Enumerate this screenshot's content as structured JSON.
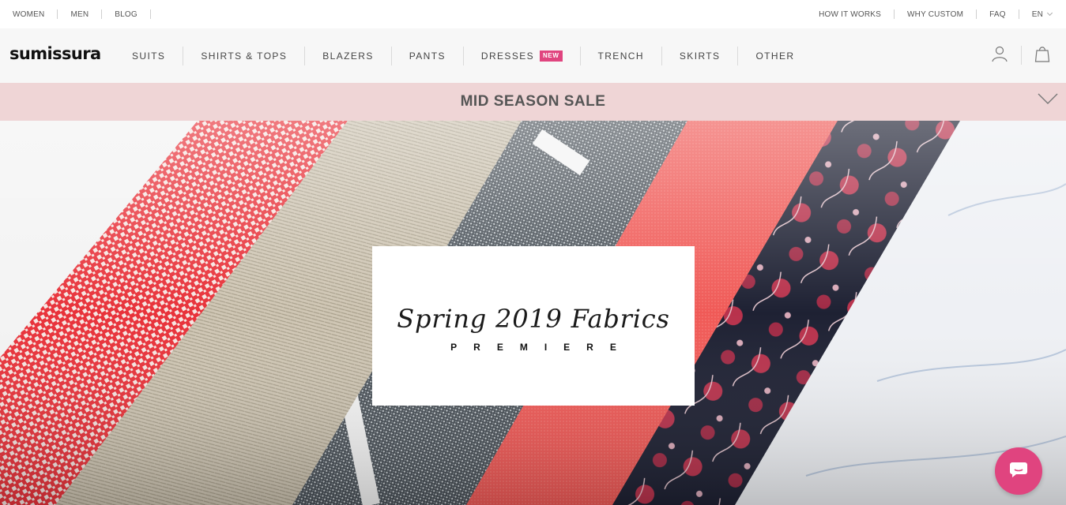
{
  "utility": {
    "left_links": [
      "WOMEN",
      "MEN",
      "BLOG"
    ],
    "right_links": [
      "HOW IT WORKS",
      "WHY CUSTOM",
      "FAQ"
    ],
    "language": "EN"
  },
  "brand": {
    "logo_text": "sumissura"
  },
  "nav": {
    "items": [
      {
        "label": "SUITS"
      },
      {
        "label": "SHIRTS & TOPS"
      },
      {
        "label": "BLAZERS"
      },
      {
        "label": "PANTS"
      },
      {
        "label": "DRESSES",
        "badge": "NEW"
      },
      {
        "label": "TRENCH"
      },
      {
        "label": "SKIRTS"
      },
      {
        "label": "OTHER"
      }
    ],
    "icons": [
      "user-icon",
      "shopping-bag-icon"
    ]
  },
  "sale_banner": {
    "text": "MID SEASON SALE",
    "icon": "chevron-down-icon"
  },
  "hero": {
    "title": "Spring 2019 Fabrics",
    "subtitle": "PREMIERE"
  },
  "chat": {
    "icon": "chat-bubble-icon"
  },
  "colors": {
    "accent": "#e0447f",
    "banner_bg": "#efd5d6",
    "nav_bg": "#f7f7f7"
  }
}
